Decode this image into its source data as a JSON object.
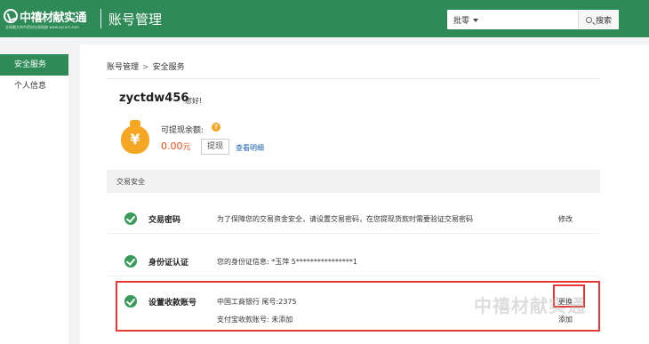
{
  "header": {
    "logo_text": "中禧材献实通",
    "logo_subtext": "全球最大的中药材交易网络 www.zycnct.com",
    "title": "账号管理",
    "search": {
      "selected_option": "批零",
      "placeholder": "",
      "button_label": "搜索"
    }
  },
  "sidebar": {
    "items": [
      {
        "label": "安全服务"
      },
      {
        "label": "个人信息"
      }
    ]
  },
  "breadcrumb": {
    "items": [
      "账号管理",
      "安全服务"
    ],
    "separator": ">"
  },
  "account": {
    "username": "zyctdw456",
    "greeting": "您好!",
    "balance_label": "可提现余额:",
    "balance_value": "0.00",
    "balance_unit": "元",
    "withdraw_label": "提现",
    "detail_link": "查看明细",
    "currency_symbol": "¥",
    "help_symbol": "?"
  },
  "security": {
    "section_title": "交易安全",
    "rows": [
      {
        "name": "交易密码",
        "desc": "为了保障您的交易资金安全，请设置交易密码，在您提现货款时需要验证交易密码",
        "action": "修改"
      },
      {
        "name": "身份证认证",
        "desc": "您的身份证信息: *玉萍  5****************1",
        "action": ""
      },
      {
        "name": "设置收款账号",
        "desc_line1": "中国工商银行  尾号:2375",
        "desc_line2": "支付宝收款账号: 未添加",
        "action1": "更换",
        "action2": "添加"
      }
    ]
  },
  "watermark_text": "中禧材献实通",
  "colors": {
    "brand": "#2e8b57",
    "accent": "#e8501a",
    "highlight": "#e53935",
    "coin": "#f5a623",
    "link": "#1a5fb4"
  },
  "icons": {
    "search": "search-icon",
    "check": "check-circle-icon",
    "money_bag": "money-bag-icon",
    "help": "help-icon"
  }
}
